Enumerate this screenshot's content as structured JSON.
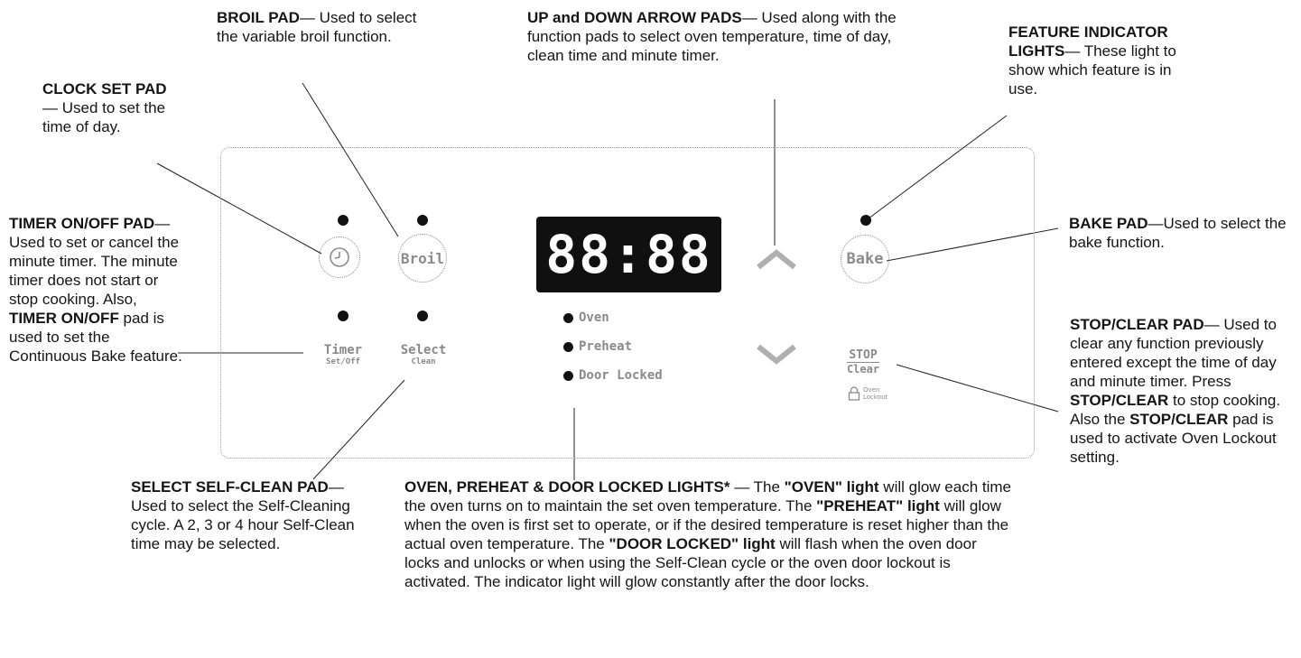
{
  "callouts": {
    "broil": {
      "title": "BROIL PAD",
      "text": "— Used to select the variable broil function."
    },
    "clock": {
      "title": "CLOCK SET PAD",
      "text": "— Used to set the time of day."
    },
    "timer": {
      "title": "TIMER ON/OFF PAD",
      "text": "— Used to set or cancel the minute timer. The minute timer does not start or stop cooking. Also,",
      "title2": "TIMER ON/OFF",
      "text2": " pad is used to set the Continuous Bake feature."
    },
    "updown": {
      "title": "UP and DOWN ARROW PADS",
      "text": "— Used along with the function pads to select oven temperature, time of day, clean time and minute timer."
    },
    "feature": {
      "title": "FEATURE INDICATOR LIGHTS",
      "text": "— These light to show which feature is in use."
    },
    "bake": {
      "title": "BAKE PAD",
      "text": "—Used to select the bake function."
    },
    "stop": {
      "title": "STOP/CLEAR PAD",
      "text1": "— Used to clear any function previously entered except the time of day and minute timer. Press ",
      "title2": "STOP/CLEAR",
      "text2": " to stop cooking. Also the ",
      "title3": "STOP/CLEAR",
      "text3": " pad is used to activate Oven Lockout setting."
    },
    "select": {
      "title": "SELECT SELF-CLEAN PAD",
      "text": "— Used to select the Self-Cleaning cycle. A 2, 3 or 4 hour Self-Clean time may be selected."
    },
    "lights": {
      "title": "OVEN, PREHEAT & DOOR LOCKED LIGHTS*",
      "t1": " — The ",
      "b1": "\"OVEN\" light",
      "t2": " will glow each time the oven turns on to maintain the set oven temperature. The ",
      "b2": "\"PREHEAT\" light",
      "t3": " will glow when the oven is first set to operate, or if the desired temperature is reset higher than the actual oven temperature. The ",
      "b3": "\"DOOR LOCKED\" light",
      "t4": " will flash when the oven door locks and unlocks or when using the Self-Clean cycle or the oven door lockout is activated. The indicator light will glow constantly after the door locks."
    }
  },
  "panel": {
    "display": "88:88",
    "broil_label": "Broil",
    "bake_label": "Bake",
    "timer_label": "Timer",
    "timer_sub": "Set/Off",
    "select_label": "Select",
    "select_sub": "Clean",
    "stop_label": "STOP",
    "clear_label": "Clear",
    "lockout_line1": "Oven",
    "lockout_line2": "Lockout",
    "indicators": [
      "Oven",
      "Preheat",
      "Door Locked"
    ]
  },
  "colors": {
    "display_bg": "#101010",
    "pad_text": "#8c8c8c",
    "arrow": "#b0b0b0"
  },
  "icons": {
    "clock": "clock-icon",
    "lock": "lock-icon",
    "up": "chevron-up-icon",
    "down": "chevron-down-icon"
  }
}
